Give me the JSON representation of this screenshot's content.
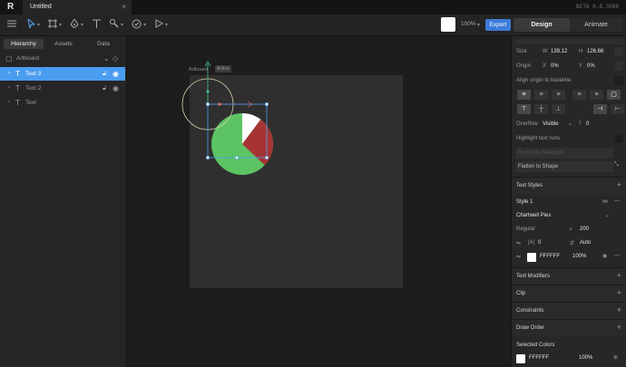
{
  "titlebar": {
    "doc_title": "Untitled",
    "close": "×",
    "version": "BETA 0.8.3088",
    "logo": "R"
  },
  "toolbar": {
    "menu_icon": "hamburger-icon",
    "zoom": "100%",
    "export_label": "Export",
    "design_label": "Design",
    "animate_label": "Animate",
    "fill_color": "#ffffff"
  },
  "left": {
    "tabs": [
      "Hierarchy",
      "Assets",
      "Data"
    ],
    "artboard_label": "Artboard",
    "layers": [
      "Text 3",
      "Text 2",
      "Text"
    ]
  },
  "canvas": {
    "artboard_name": "Artboard",
    "state_badge": "Active",
    "pie_colors": {
      "green": "#5cc463",
      "red": "#a63434",
      "white": "#ffffff"
    }
  },
  "right": {
    "size_label": "Size",
    "w_label": "W",
    "w_value": "139.12",
    "h_label": "H",
    "h_value": "126.66",
    "origin_label": "Origin",
    "x_label": "X",
    "x_value": "0%",
    "y_label": "Y",
    "y_value": "0%",
    "align_baseline": "Align origin to baseline",
    "overflow_label": "Overflow",
    "overflow_value": "Visible",
    "overflow_num": "0",
    "highlight_runs": "Highlight text runs",
    "run_from_selection": "Run from Selection",
    "flatten_to_shape": "Flatten to Shape",
    "text_styles": "Text Styles",
    "style_name": "Style 1",
    "font_name": "Chartwell Pies",
    "weight": "Regular",
    "size_value": "200",
    "tracking_value": "0",
    "line_height_value": "Auto",
    "fill_hex": "FFFFFF",
    "fill_opacity": "100%",
    "text_modifiers": "Text Modifiers",
    "clip": "Clip",
    "constraints": "Constraints",
    "draw_order": "Draw Order",
    "selected_colors": "Selected Colors",
    "sel_hex": "FFFFFF",
    "sel_opacity": "100%"
  }
}
